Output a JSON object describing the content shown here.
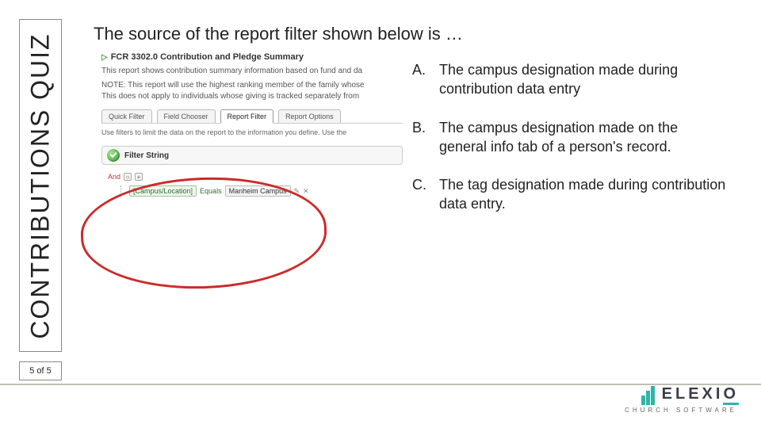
{
  "sidebar": {
    "tag": "CONTRIBUTIONS QUIZ",
    "pager": "5 of 5"
  },
  "question": "The source of the report filter shown below is …",
  "screenshot": {
    "report_title": "FCR 3302.0 Contribution and Pledge Summary",
    "description": "This report shows contribution summary information based on fund and da",
    "note_line1": "NOTE: This report will use the highest ranking member of the family whose",
    "note_line2": "This does not apply to individuals whose giving is tracked separately from",
    "tabs": {
      "t1": "Quick Filter",
      "t2": "Field Chooser",
      "t3": "Report Filter",
      "t4": "Report Options"
    },
    "filter_hint": "Use filters to limit the data on the report to the information you define. Use the",
    "filter_header": "Filter String",
    "tree": {
      "and": "And",
      "field": "[Campus/Location]",
      "op": "Equals",
      "value": "Manheim Campus"
    }
  },
  "answers": {
    "a": {
      "letter": "A.",
      "text": "The campus designation made during contribution data entry"
    },
    "b": {
      "letter": "B.",
      "text": "The campus designation made on the general info tab of a person's record."
    },
    "c": {
      "letter": "C.",
      "text": "The tag designation made during contribution data entry."
    }
  },
  "logo": {
    "word": "ELEXI",
    "accent": "O",
    "sub": "CHURCH SOFTWARE"
  }
}
